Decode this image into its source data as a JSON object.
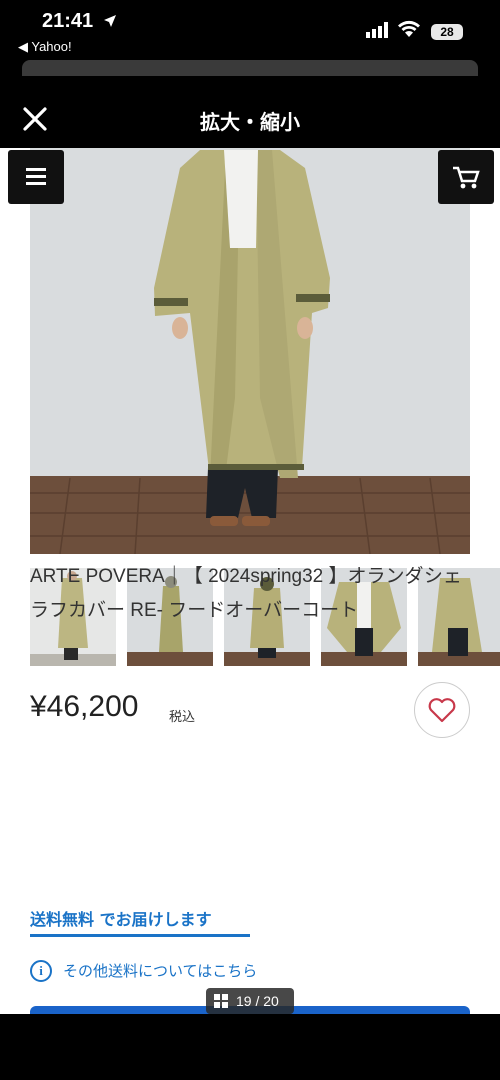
{
  "status_bar": {
    "time": "21:41",
    "back_app": "◀ Yahoo!",
    "battery": "28"
  },
  "viewer": {
    "title": "拡大・縮小",
    "close_icon": "close-icon",
    "counter": "19 / 20"
  },
  "product": {
    "title": "ARTE POVERA｜【 2024spring32 】オランダシェラフカバー RE- フードオーバーコート",
    "price": "¥46,200",
    "tax_label": "税込",
    "shipping_label": "送料無料 でお届けします",
    "shipping_info": "その他送料についてはこちら"
  },
  "colors": {
    "accent": "#1a73c7",
    "coat": "#b9b27c"
  }
}
